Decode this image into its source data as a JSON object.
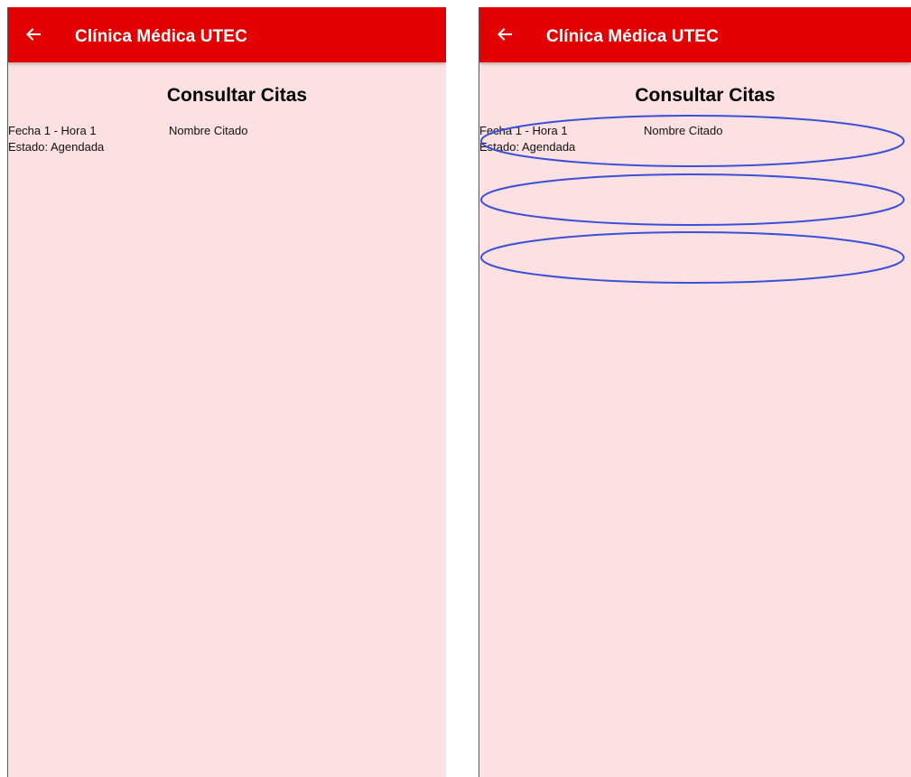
{
  "app": {
    "title": "Clínica Médica UTEC",
    "back_icon": "arrow-left-icon",
    "accent_color": "#e30000",
    "background_color": "#fde0e1",
    "annotation_color": "#3b4fd8"
  },
  "screen": {
    "title": "Consultar Citas"
  },
  "citas": [
    {
      "fecha_hora": "Fecha 1 - Hora 1",
      "nombre": "Nombre Citado",
      "estado_label": "Estado:",
      "estado": "Agendada"
    }
  ]
}
